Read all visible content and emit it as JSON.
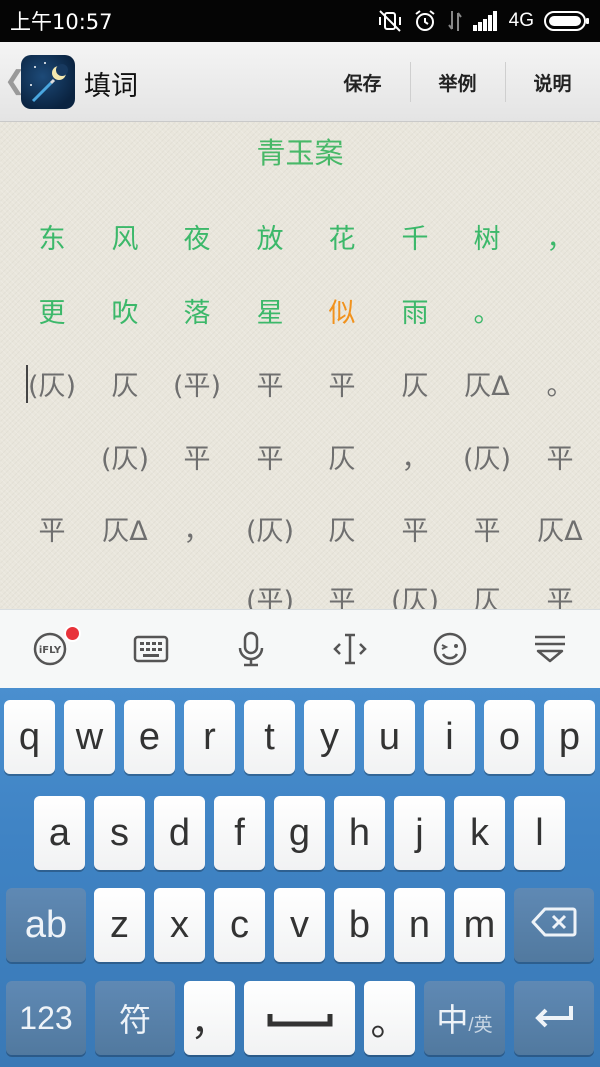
{
  "status_bar": {
    "time": "上午10:57",
    "network": "4G"
  },
  "app_bar": {
    "title": "填词",
    "actions": [
      "保存",
      "举例",
      "说明"
    ]
  },
  "poem": {
    "title": "青玉案",
    "rows": [
      [
        "东",
        "风",
        "夜",
        "放",
        "花",
        "千",
        "树",
        "，"
      ],
      [
        "更",
        "吹",
        "落",
        "星",
        "似",
        "雨",
        "。",
        ""
      ],
      [
        "(仄)",
        "仄",
        "(平)",
        "平",
        "平",
        "仄",
        "仄Δ",
        "。"
      ],
      [
        "",
        "(仄)",
        "平",
        "平",
        "仄",
        "，",
        "(仄)",
        "平"
      ],
      [
        "平",
        "仄Δ",
        "，",
        "(仄)",
        "仄",
        "平",
        "平",
        "仄Δ"
      ],
      [
        "",
        "",
        "",
        "(平)",
        "平",
        "(仄)",
        "仄",
        "平"
      ]
    ],
    "highlight": "似"
  },
  "keyboard_toolbar": [
    "ifly-icon",
    "keyboard-icon",
    "microphone-icon",
    "cursor-icon",
    "emoji-icon",
    "hide-keyboard-icon"
  ],
  "keyboard": {
    "row1": [
      "q",
      "w",
      "e",
      "r",
      "t",
      "y",
      "u",
      "i",
      "o",
      "p"
    ],
    "row2": [
      "a",
      "s",
      "d",
      "f",
      "g",
      "h",
      "j",
      "k",
      "l"
    ],
    "row3_left": "ab",
    "row3": [
      "z",
      "x",
      "c",
      "v",
      "b",
      "n",
      "m"
    ],
    "row4": {
      "num": "123",
      "sym": "符",
      "comma": "，",
      "period": "。",
      "lang_main": "中",
      "lang_sub": "/英"
    }
  },
  "colors": {
    "verse": "#3cb86a",
    "highlight": "#f1921d",
    "pattern": "#6f6f6f",
    "keyboard_bg": "#3f83c4"
  }
}
